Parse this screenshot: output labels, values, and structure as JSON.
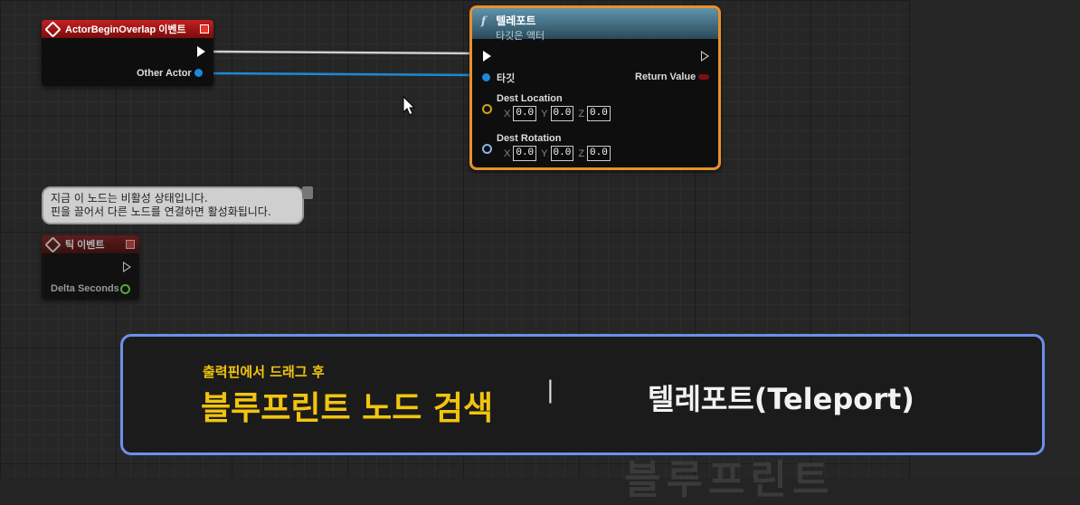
{
  "begin_overlap_node": {
    "title": "ActorBeginOverlap 이벤트",
    "other_actor_label": "Other Actor",
    "header_color": "#b01515"
  },
  "teleport_node": {
    "title": "텔레포트",
    "subtitle": "타깃은 액터",
    "function_icon": "f",
    "target_label": "타깃",
    "return_label": "Return Value",
    "dest_location_label": "Dest Location",
    "dest_rotation_label": "Dest Rotation",
    "dest_location": {
      "x_label": "X",
      "x": "0.0",
      "y_label": "Y",
      "y": "0.0",
      "z_label": "Z",
      "z": "0.0"
    },
    "dest_rotation": {
      "x_label": "X",
      "x": "0.0",
      "y_label": "Y",
      "y": "0.0",
      "z_label": "Z",
      "z": "0.0"
    },
    "header_color": "#4d7d95",
    "selection_color": "#e8912a"
  },
  "tick_node": {
    "title": "틱 이벤트",
    "delta_label": "Delta Seconds",
    "comment_line1": "지금 이 노드는 비활성 상태입니다.",
    "comment_line2": "핀을 끌어서 다른 노드를 연결하면 활성화됩니다."
  },
  "banner": {
    "small_text": "출력핀에서 드래그 후",
    "big_text": "블루프린트 노드 검색",
    "separator": "|",
    "right_text": "텔레포트(Teleport)",
    "accent_color": "#f1c40f",
    "border_color": "#6f8fe8"
  },
  "background_ghost_text": "블루프린트",
  "colors": {
    "exec_wire": "#cfcfcf",
    "object_wire": "#1e88d8",
    "vector_pin": "#d4a017",
    "rotator_pin": "#8ab4e8",
    "float_pin": "#5fbf3f"
  }
}
